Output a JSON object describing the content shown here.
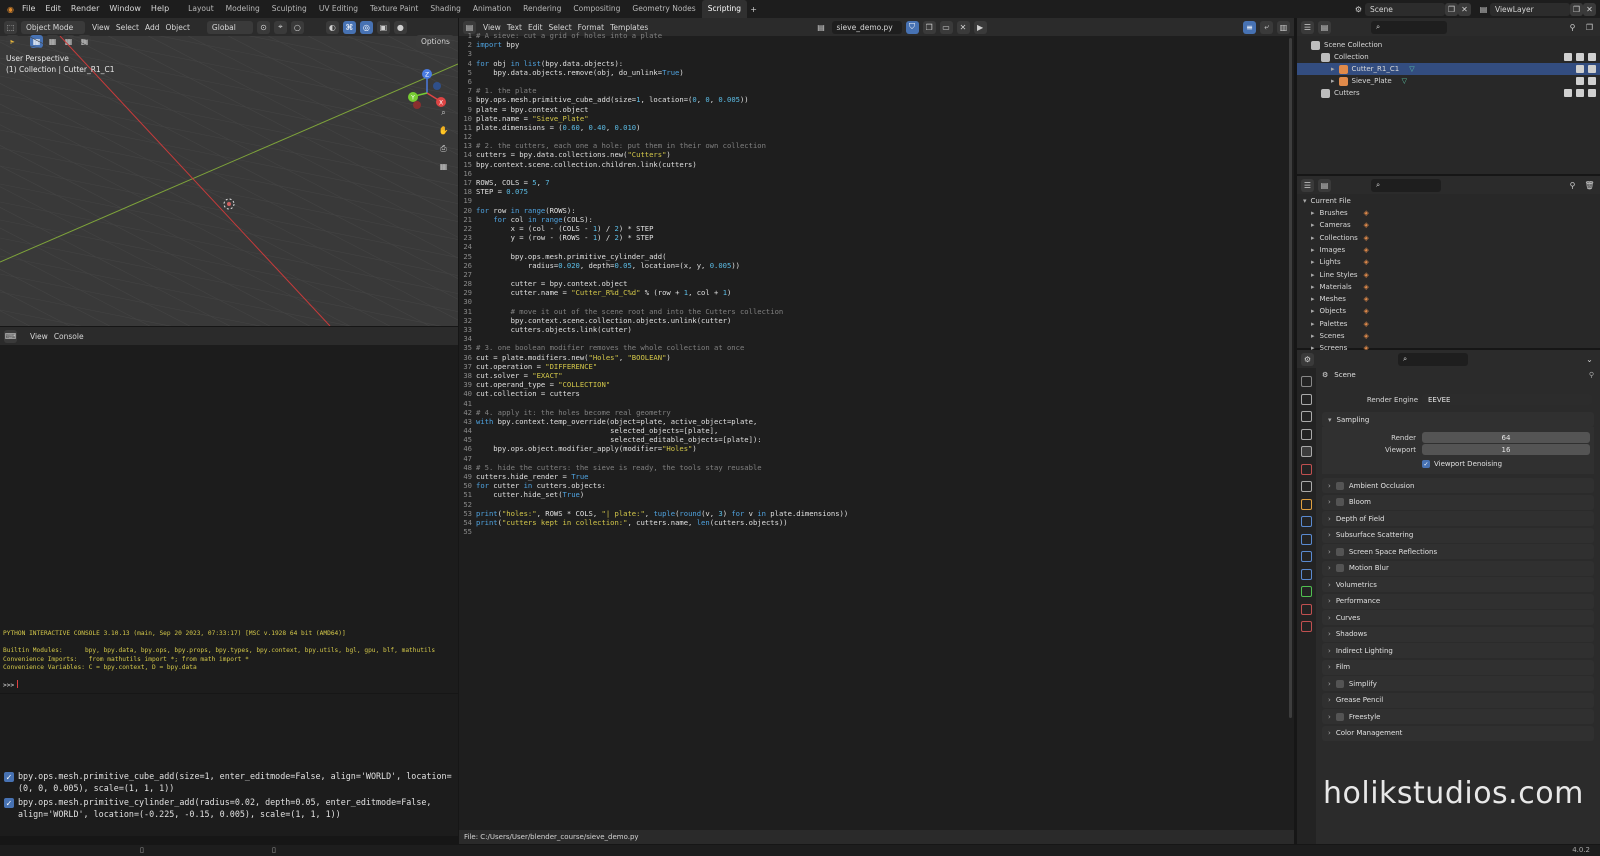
{
  "topbar": {
    "menus": [
      "File",
      "Edit",
      "Render",
      "Window",
      "Help"
    ],
    "workspaces": [
      "Layout",
      "Modeling",
      "Sculpting",
      "UV Editing",
      "Texture Paint",
      "Shading",
      "Animation",
      "Rendering",
      "Compositing",
      "Geometry Nodes",
      "Scripting"
    ],
    "active_workspace": "Scripting",
    "scene_label": "Scene",
    "viewlayer_label": "ViewLayer"
  },
  "viewport": {
    "mode": "Object Mode",
    "menus": [
      "View",
      "Select",
      "Add",
      "Object"
    ],
    "transform": "Global",
    "options": "Options",
    "perspective": "User Perspective",
    "context": "(1) Collection | Cutter_R1_C1"
  },
  "console": {
    "menus": [
      "View",
      "Console"
    ],
    "lines": [
      "PYTHON INTERACTIVE CONSOLE 3.10.13 (main, Sep 20 2023, 07:33:17) [MSC v.1928 64 bit (AMD64)]",
      "",
      "Builtin Modules:      bpy, bpy.data, bpy.ops, bpy.props, bpy.types, bpy.context, bpy.utils, bgl, gpu, blf, mathutils",
      "Convenience Imports:   from mathutils import *; from math import *",
      "Convenience Variables: C = bpy.context, D = bpy.data",
      "",
      ">>> "
    ]
  },
  "info_log": [
    "bpy.ops.mesh.primitive_cube_add(size=1, enter_editmode=False, align='WORLD', location=(0, 0, 0.005), scale=(1, 1, 1))",
    "bpy.ops.mesh.primitive_cylinder_add(radius=0.02, depth=0.05, enter_editmode=False, align='WORLD', location=(-0.225, -0.15, 0.005), scale=(1, 1, 1))"
  ],
  "text_editor": {
    "menus": [
      "View",
      "Text",
      "Edit",
      "Select",
      "Format",
      "Templates"
    ],
    "filename": "sieve_demo.py",
    "file_path": "File: C:/Users/User/blender_course/sieve_demo.py",
    "code": [
      "# A sieve: cut a grid of holes into a plate",
      "import bpy",
      "",
      "for obj in list(bpy.data.objects):",
      "    bpy.data.objects.remove(obj, do_unlink=True)",
      "",
      "# 1. the plate",
      "bpy.ops.mesh.primitive_cube_add(size=1, location=(0, 0, 0.005))",
      "plate = bpy.context.object",
      "plate.name = \"Sieve_Plate\"",
      "plate.dimensions = (0.60, 0.40, 0.010)",
      "",
      "# 2. the cutters, each one a hole: put them in their own collection",
      "cutters = bpy.data.collections.new(\"Cutters\")",
      "bpy.context.scene.collection.children.link(cutters)",
      "",
      "ROWS, COLS = 5, 7",
      "STEP = 0.075",
      "",
      "for row in range(ROWS):",
      "    for col in range(COLS):",
      "        x = (col - (COLS - 1) / 2) * STEP",
      "        y = (row - (ROWS - 1) / 2) * STEP",
      "",
      "        bpy.ops.mesh.primitive_cylinder_add(",
      "            radius=0.020, depth=0.05, location=(x, y, 0.005))",
      "",
      "        cutter = bpy.context.object",
      "        cutter.name = \"Cutter_R%d_C%d\" % (row + 1, col + 1)",
      "",
      "        # move it out of the scene root and into the Cutters collection",
      "        bpy.context.scene.collection.objects.unlink(cutter)",
      "        cutters.objects.link(cutter)",
      "",
      "# 3. one boolean modifier removes the whole collection at once",
      "cut = plate.modifiers.new(\"Holes\", \"BOOLEAN\")",
      "cut.operation = \"DIFFERENCE\"",
      "cut.solver = \"EXACT\"",
      "cut.operand_type = \"COLLECTION\"",
      "cut.collection = cutters",
      "",
      "# 4. apply it: the holes become real geometry",
      "with bpy.context.temp_override(object=plate, active_object=plate,",
      "                               selected_objects=[plate],",
      "                               selected_editable_objects=[plate]):",
      "    bpy.ops.object.modifier_apply(modifier=\"Holes\")",
      "",
      "# 5. hide the cutters: the sieve is ready, the tools stay reusable",
      "cutters.hide_render = True",
      "for cutter in cutters.objects:",
      "    cutter.hide_set(True)",
      "",
      "print(\"holes:\", ROWS * COLS, \"| plate:\", tuple(round(v, 3) for v in plate.dimensions))",
      "print(\"cutters kept in collection:\", cutters.name, len(cutters.objects))",
      ""
    ]
  },
  "outliner": {
    "root": "Scene Collection",
    "items": [
      {
        "label": "Collection",
        "depth": 1,
        "selected": false
      },
      {
        "label": "Cutter_R1_C1",
        "depth": 2,
        "selected": true
      },
      {
        "label": "Sieve_Plate",
        "depth": 2,
        "selected": false
      },
      {
        "label": "Cutters",
        "depth": 1,
        "selected": false
      }
    ]
  },
  "blend_file": {
    "root": "Current File",
    "items": [
      "Brushes",
      "Cameras",
      "Collections",
      "Images",
      "Lights",
      "Line Styles",
      "Materials",
      "Meshes",
      "Objects",
      "Palettes",
      "Scenes",
      "Screens"
    ]
  },
  "properties": {
    "context": "Scene",
    "render_engine_label": "Render Engine",
    "render_engine": "EEVEE",
    "sampling": {
      "title": "Sampling",
      "render_label": "Render",
      "render_value": "64",
      "viewport_label": "Viewport",
      "viewport_value": "16",
      "denoise_label": "Viewport Denoising"
    },
    "sections": [
      {
        "label": "Ambient Occlusion",
        "checkbox": true
      },
      {
        "label": "Bloom",
        "checkbox": true
      },
      {
        "label": "Depth of Field",
        "checkbox": false
      },
      {
        "label": "Subsurface Scattering",
        "checkbox": false
      },
      {
        "label": "Screen Space Reflections",
        "checkbox": true
      },
      {
        "label": "Motion Blur",
        "checkbox": true
      },
      {
        "label": "Volumetrics",
        "checkbox": false
      },
      {
        "label": "Performance",
        "checkbox": false
      },
      {
        "label": "Curves",
        "checkbox": false
      },
      {
        "label": "Shadows",
        "checkbox": false
      },
      {
        "label": "Indirect Lighting",
        "checkbox": false
      },
      {
        "label": "Film",
        "checkbox": false
      },
      {
        "label": "Simplify",
        "checkbox": true
      },
      {
        "label": "Grease Pencil",
        "checkbox": false
      },
      {
        "label": "Freestyle",
        "checkbox": true
      },
      {
        "label": "Color Management",
        "checkbox": false
      }
    ]
  },
  "watermark": "holikstudios.com",
  "version": "4.0.2",
  "colors": {
    "accent": "#4772b3",
    "selection": "#334d80",
    "grid_x_axis": "#c83a3a",
    "grid_y_axis": "#7ea33a",
    "console_text": "#d4c84a"
  }
}
